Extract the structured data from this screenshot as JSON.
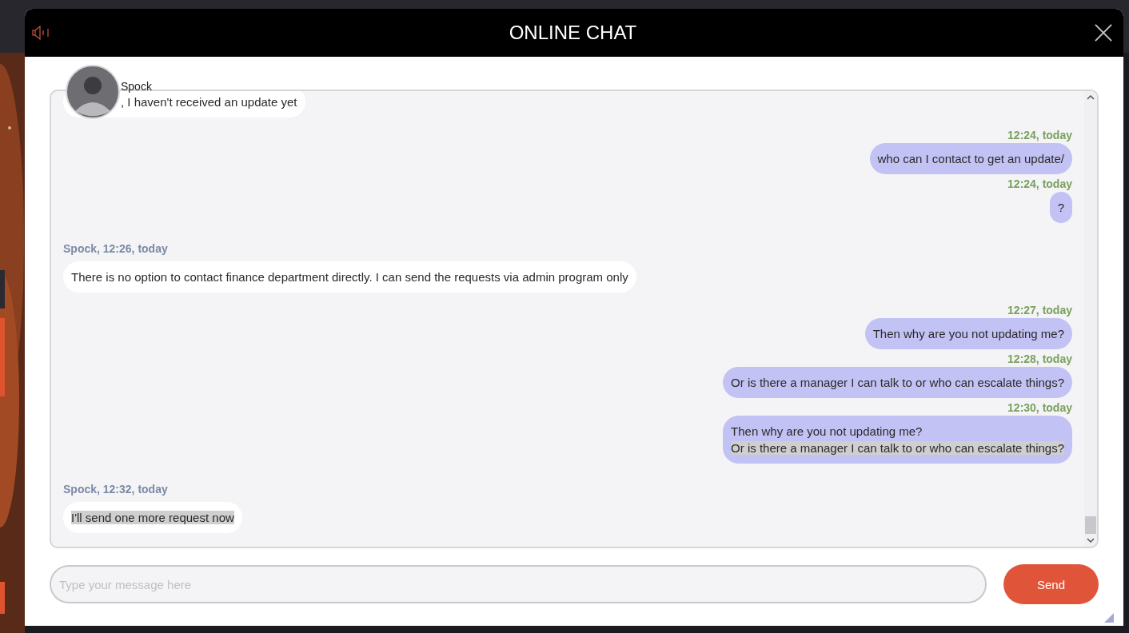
{
  "window": {
    "title": "ONLINE CHAT"
  },
  "agent": {
    "name": "Spock"
  },
  "messages": [
    {
      "kind": "agent",
      "lines": [
        {
          "text": ", I haven't received an update yet",
          "highlighted": false
        }
      ]
    },
    {
      "kind": "user",
      "header": "12:24, today",
      "lines": [
        {
          "text": "who can I contact to get an update/",
          "highlighted": false
        }
      ]
    },
    {
      "kind": "user",
      "header": "12:24, today",
      "lines": [
        {
          "text": "?",
          "highlighted": false
        }
      ]
    },
    {
      "kind": "agent",
      "header": "Spock, 12:26, today",
      "lines": [
        {
          "text": "There is no option to contact finance department directly. I can send the requests via admin program only",
          "highlighted": false
        }
      ]
    },
    {
      "kind": "user",
      "header": "12:27, today",
      "lines": [
        {
          "text": "Then why are you not updating me?",
          "highlighted": false
        }
      ]
    },
    {
      "kind": "user",
      "header": "12:28, today",
      "lines": [
        {
          "text": "Or is there a manager I can talk to or who can escalate things?",
          "highlighted": false
        }
      ]
    },
    {
      "kind": "user",
      "header": "12:30, today",
      "lines": [
        {
          "text": "Then why are you not updating me?",
          "highlighted": false
        },
        {
          "text": "Or is there a manager I can talk to or who can escalate things?",
          "highlighted": true
        }
      ]
    },
    {
      "kind": "agent",
      "header": "Spock, 12:32, today",
      "lines": [
        {
          "text": "I'll send one more request now",
          "highlighted": true
        }
      ]
    }
  ],
  "composer": {
    "placeholder": "Type your message here",
    "send": "Send"
  }
}
